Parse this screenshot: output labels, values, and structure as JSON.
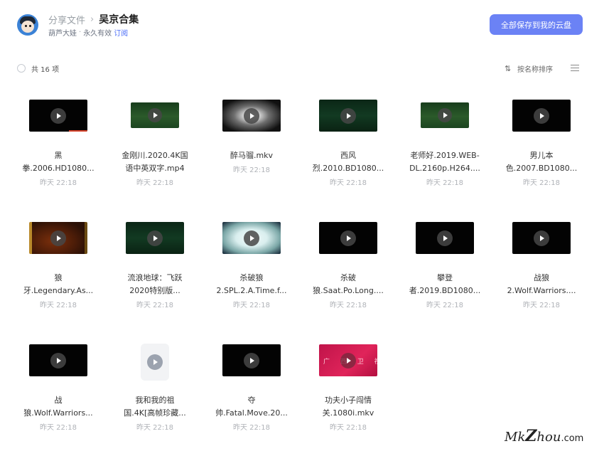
{
  "header": {
    "crumb_root": "分享文件",
    "crumb_sep": "›",
    "crumb_current": "吴京合集",
    "owner": "葫芦大娃",
    "meta_dot": "·",
    "validity": "永久有效",
    "subscribe": "订阅",
    "save_all_label": "全部保存到我的云盘"
  },
  "toolbar": {
    "count_label": "共 16 项",
    "sort_label": "按名称排序"
  },
  "files": [
    {
      "line1": "黑",
      "line2": "拳.2006.HD1080...",
      "time": "昨天 22:18",
      "thumb": "dark"
    },
    {
      "line1": "金刚川.2020.4K国",
      "line2": "语中英双字.mp4",
      "time": "昨天 22:18",
      "thumb": "green"
    },
    {
      "line1": "醉马骝.mkv",
      "line2": "",
      "time": "昨天 22:18",
      "thumb": "glow"
    },
    {
      "line1": "西风",
      "line2": "烈.2010.BD1080...",
      "time": "昨天 22:18",
      "thumb": "green2"
    },
    {
      "line1": "老师好.2019.WEB-",
      "line2": "DL.2160p.H264....",
      "time": "昨天 22:18",
      "thumb": "green"
    },
    {
      "line1": "男儿本",
      "line2": "色.2007.BD1080...",
      "time": "昨天 22:18",
      "thumb": "dark"
    },
    {
      "line1": "狼",
      "line2": "牙.Legendary.As...",
      "time": "昨天 22:18",
      "thumb": "amber"
    },
    {
      "line1": "流浪地球：飞跃",
      "line2": "2020特别版...",
      "time": "昨天 22:18",
      "thumb": "green2"
    },
    {
      "line1": "杀破狼",
      "line2": "2.SPL.2.A.Time.f...",
      "time": "昨天 22:18",
      "thumb": "cyan"
    },
    {
      "line1": "杀破",
      "line2": "狼.Saat.Po.Long....",
      "time": "昨天 22:18",
      "thumb": "dark"
    },
    {
      "line1": "攀登",
      "line2": "者.2019.BD1080...",
      "time": "昨天 22:18",
      "thumb": "dark"
    },
    {
      "line1": "战狼",
      "line2": "2.Wolf.Warriors....",
      "time": "昨天 22:18",
      "thumb": "dark"
    },
    {
      "line1": "战",
      "line2": "狼.Wolf.Warriors...",
      "time": "昨天 22:18",
      "thumb": "dark"
    },
    {
      "line1": "我和我的祖",
      "line2": "国.4K[高帧珍藏...",
      "time": "昨天 22:18",
      "thumb": "doc"
    },
    {
      "line1": "夺",
      "line2": "帅.Fatal.Move.20...",
      "time": "昨天 22:18",
      "thumb": "dark"
    },
    {
      "line1": "功夫小子闯情",
      "line2": "关.1080i.mkv",
      "time": "昨天 22:18",
      "thumb": "pink"
    }
  ],
  "pink_thumb_text": "广 西 卫 视 片 厂",
  "watermark": {
    "a": "M",
    "b": "k",
    "c": "Z",
    "d": "hou",
    "e": ".com"
  },
  "colors": {
    "accent": "#6b82f5",
    "link": "#4a6cf7"
  }
}
